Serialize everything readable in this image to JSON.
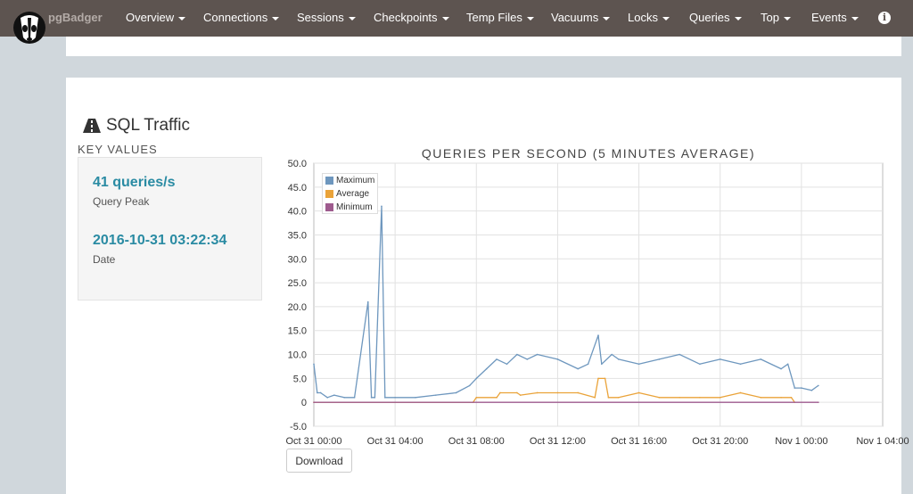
{
  "navbar": {
    "brand": "pgBadger",
    "items": [
      {
        "label": "Overview",
        "x": 141
      },
      {
        "label": "Connections",
        "x": 228
      },
      {
        "label": "Sessions",
        "x": 333
      },
      {
        "label": "Checkpoints",
        "x": 419
      },
      {
        "label": "Temp Files",
        "x": 523
      },
      {
        "label": "Vacuums",
        "x": 618
      },
      {
        "label": "Locks",
        "x": 704
      },
      {
        "label": "Queries",
        "x": 773
      },
      {
        "label": "Top",
        "x": 853
      },
      {
        "label": "Events",
        "x": 910
      }
    ]
  },
  "section": {
    "title": "SQL Traffic",
    "key_values_label": "Key values",
    "key_values": [
      {
        "value": "41 queries/s",
        "label": "Query Peak"
      },
      {
        "value": "2016-10-31 03:22:34",
        "label": "Date"
      }
    ]
  },
  "download_label": "Download",
  "colors": {
    "maximum": "#6e97be",
    "average": "#eaa339",
    "minimum": "#9e5b8e"
  },
  "chart_data": {
    "type": "line",
    "title": "QUERIES PER SECOND (5 MINUTES AVERAGE)",
    "xlabel": "",
    "ylabel": "",
    "ylim": [
      -5,
      50
    ],
    "yticks": [
      "50.0",
      "45.0",
      "40.0",
      "35.0",
      "30.0",
      "25.0",
      "20.0",
      "15.0",
      "10.0",
      "5.0",
      "0",
      "-5.0"
    ],
    "xlim": [
      "2016-10-31 00:00",
      "2016-11-01 04:00"
    ],
    "xticks": [
      "Oct 31 00:00",
      "Oct 31 04:00",
      "Oct 31 08:00",
      "Oct 31 12:00",
      "Oct 31 16:00",
      "Oct 31 20:00",
      "Nov 1 00:00",
      "Nov 1 04:00"
    ],
    "grid": true,
    "legend_position": "top-left",
    "series": [
      {
        "name": "Maximum",
        "x": [
          "Oct 31 00:00",
          "Oct 31 00:10",
          "Oct 31 00:20",
          "Oct 31 00:40",
          "Oct 31 01:00",
          "Oct 31 01:30",
          "Oct 31 02:00",
          "Oct 31 02:40",
          "Oct 31 02:50",
          "Oct 31 03:00",
          "Oct 31 03:20",
          "Oct 31 03:30",
          "Oct 31 04:00",
          "Oct 31 05:00",
          "Oct 31 06:00",
          "Oct 31 07:00",
          "Oct 31 07:40",
          "Oct 31 08:00",
          "Oct 31 08:30",
          "Oct 31 09:00",
          "Oct 31 09:30",
          "Oct 31 10:00",
          "Oct 31 10:30",
          "Oct 31 11:00",
          "Oct 31 12:00",
          "Oct 31 13:00",
          "Oct 31 13:30",
          "Oct 31 14:00",
          "Oct 31 14:10",
          "Oct 31 14:40",
          "Oct 31 15:00",
          "Oct 31 16:00",
          "Oct 31 17:00",
          "Oct 31 18:00",
          "Oct 31 19:00",
          "Oct 31 20:00",
          "Oct 31 21:00",
          "Oct 31 22:00",
          "Oct 31 23:00",
          "Oct 31 23:20",
          "Oct 31 23:40",
          "Nov 1 00:00",
          "Nov 1 00:30",
          "Nov 1 00:50"
        ],
        "y": [
          8,
          2,
          2,
          1,
          1.5,
          1,
          1,
          21,
          1,
          1,
          41,
          1,
          1,
          1,
          1.5,
          2,
          3.5,
          5,
          7,
          9,
          8,
          10,
          9,
          10,
          9,
          7,
          8,
          14,
          8,
          10,
          9,
          8,
          9,
          10,
          8,
          9,
          8,
          9,
          7,
          8,
          3,
          3,
          2.5,
          3.5
        ]
      },
      {
        "name": "Average",
        "x": [
          "Oct 31 00:00",
          "Oct 31 07:50",
          "Oct 31 08:00",
          "Oct 31 09:00",
          "Oct 31 09:10",
          "Oct 31 10:00",
          "Oct 31 10:10",
          "Oct 31 11:00",
          "Oct 31 12:00",
          "Oct 31 13:00",
          "Oct 31 13:50",
          "Oct 31 14:00",
          "Oct 31 14:20",
          "Oct 31 14:30",
          "Oct 31 15:00",
          "Oct 31 16:00",
          "Oct 31 17:00",
          "Oct 31 18:00",
          "Oct 31 19:00",
          "Oct 31 20:00",
          "Oct 31 21:00",
          "Oct 31 22:00",
          "Oct 31 23:00",
          "Oct 31 23:30",
          "Oct 31 23:40"
        ],
        "y": [
          0,
          0,
          1,
          1,
          2,
          2,
          1.5,
          2,
          2,
          2,
          1,
          5,
          5,
          1,
          1,
          2,
          1,
          1,
          1,
          1,
          2,
          1,
          1,
          1,
          0
        ]
      },
      {
        "name": "Minimum",
        "x": [
          "Oct 31 00:00",
          "Nov 1 00:50"
        ],
        "y": [
          0,
          0
        ]
      }
    ]
  }
}
